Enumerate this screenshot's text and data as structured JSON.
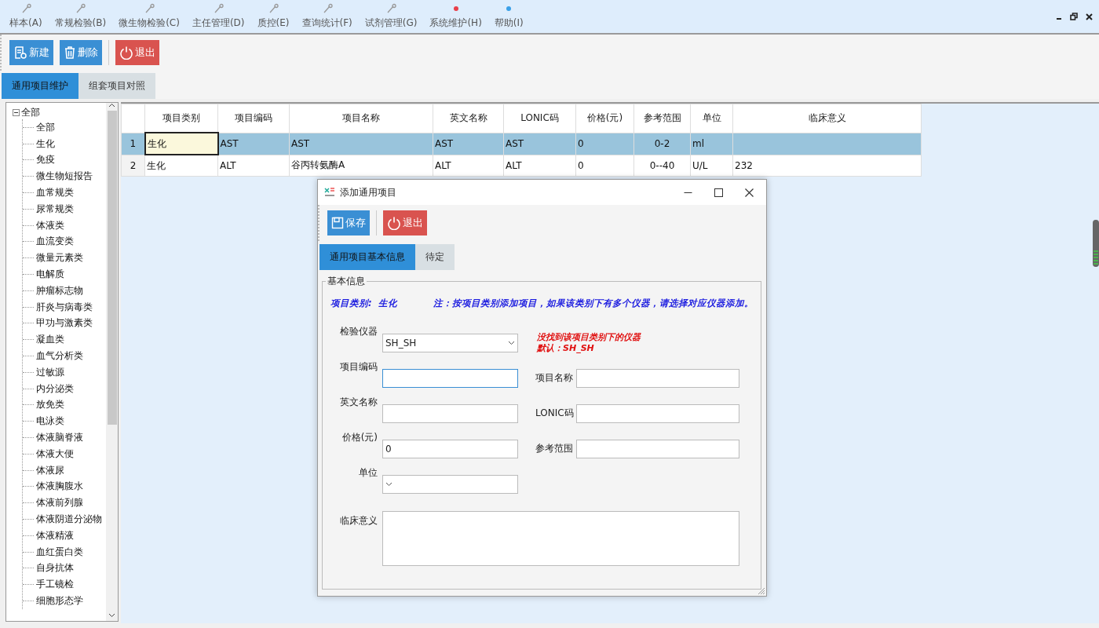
{
  "menu": [
    {
      "label": "样本(A)",
      "kind": "tool"
    },
    {
      "label": "常规检验(B)",
      "kind": "tool"
    },
    {
      "label": "微生物检验(C)",
      "kind": "tool"
    },
    {
      "label": "主任管理(D)",
      "kind": "tool"
    },
    {
      "label": "质控(E)",
      "kind": "tool"
    },
    {
      "label": "查询统计(F)",
      "kind": "tool"
    },
    {
      "label": "试剂管理(G)",
      "kind": "tool"
    },
    {
      "label": "系统维护(H)",
      "kind": "dot",
      "color": "#e8404a"
    },
    {
      "label": "帮助(I)",
      "kind": "dot",
      "color": "#3aa0e8"
    }
  ],
  "toolbar": [
    {
      "label": "新建",
      "kind": "new"
    },
    {
      "label": "删除",
      "kind": "delete"
    },
    {
      "label": "退出",
      "kind": "exit"
    }
  ],
  "tabs": [
    {
      "label": "通用项目维护",
      "selected": true
    },
    {
      "label": "组套项目对照",
      "selected": false
    }
  ],
  "tree": {
    "label": "全部",
    "expanded": true,
    "children": [
      {
        "label": "全部"
      },
      {
        "label": "生化"
      },
      {
        "label": "免疫"
      },
      {
        "label": "微生物短报告"
      },
      {
        "label": "血常规类"
      },
      {
        "label": "尿常规类"
      },
      {
        "label": "体液类"
      },
      {
        "label": "血流变类"
      },
      {
        "label": "微量元素类"
      },
      {
        "label": "电解质"
      },
      {
        "label": "肿瘤标志物"
      },
      {
        "label": "肝炎与病毒类"
      },
      {
        "label": "甲功与激素类"
      },
      {
        "label": "凝血类"
      },
      {
        "label": "血气分析类"
      },
      {
        "label": "过敏源"
      },
      {
        "label": "内分泌类"
      },
      {
        "label": "放免类"
      },
      {
        "label": "电泳类"
      },
      {
        "label": "体液脑脊液"
      },
      {
        "label": "体液大便"
      },
      {
        "label": "体液尿"
      },
      {
        "label": "体液胸腹水"
      },
      {
        "label": "体液前列腺"
      },
      {
        "label": "体液阴道分泌物"
      },
      {
        "label": "体液精液"
      },
      {
        "label": "血红蛋白类"
      },
      {
        "label": "自身抗体"
      },
      {
        "label": "手工镜检"
      },
      {
        "label": "细胞形态学"
      }
    ]
  },
  "table": {
    "columns": [
      {
        "label": "项目类别"
      },
      {
        "label": "项目编码"
      },
      {
        "label": "项目名称"
      },
      {
        "label": "英文名称"
      },
      {
        "label": "LONIC码"
      },
      {
        "label": "价格(元)"
      },
      {
        "label": "参考范围"
      },
      {
        "label": "单位"
      },
      {
        "label": "临床意义"
      }
    ],
    "rows": [
      {
        "number": "1",
        "selected": true,
        "editing": true,
        "cells": [
          "生化",
          "AST",
          "AST",
          "AST",
          "AST",
          "0",
          "0-2",
          "ml"
        ]
      },
      {
        "number": "2",
        "selected": false,
        "editing": false,
        "cells": [
          "生化",
          "ALT",
          "谷丙转氨酶A",
          "ALT",
          "ALT",
          "0",
          "0--40",
          "U/L",
          "232"
        ]
      }
    ]
  },
  "dialog": {
    "title": "添加通用项目",
    "toolbar": [
      {
        "label": "保存",
        "kind": "save"
      },
      {
        "label": "退出",
        "kind": "exit"
      }
    ],
    "tabs": [
      {
        "label": "通用项目基本信息",
        "selected": true
      },
      {
        "label": "待定",
        "selected": false
      }
    ],
    "group_title": "基本信息",
    "category_label": "项目类别:",
    "category_value": "生化",
    "note": "注：按项目类别添加项目，如果该类别下有多个仪器，请选择对应仪器添加。",
    "warning": [
      "没找到该项目类别下的仪器",
      "默认：SH_SH"
    ],
    "fields": [
      {
        "label": "检验仪器",
        "kind": "select",
        "value": "SH_SH",
        "focused": false
      },
      {
        "label": "项目编码",
        "kind": "text",
        "focused": true
      },
      {
        "label": "项目名称",
        "kind": "text",
        "focused": false
      },
      {
        "label": "英文名称",
        "kind": "text",
        "focused": false
      },
      {
        "label": "LONIC码",
        "kind": "text",
        "focused": false
      },
      {
        "label": "价格(元)",
        "kind": "text",
        "value": "0",
        "focused": false
      },
      {
        "label": "参考范围",
        "kind": "text",
        "focused": false
      },
      {
        "label": "单位",
        "kind": "select",
        "focused": false
      },
      {
        "label": "临床意义",
        "kind": "textarea",
        "focused": false
      }
    ]
  }
}
